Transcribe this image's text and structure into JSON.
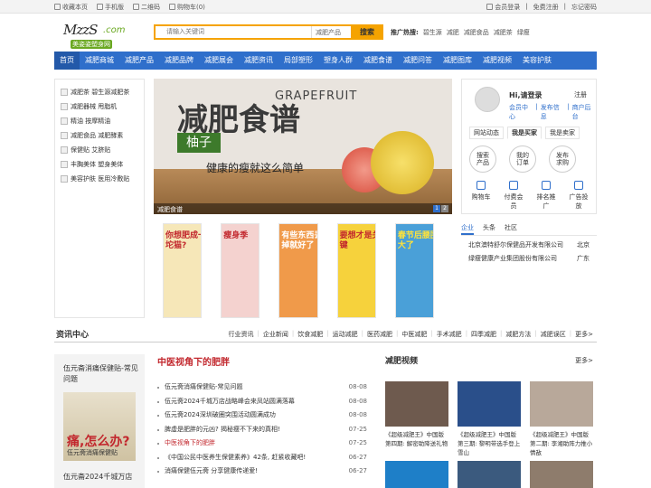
{
  "topbar": {
    "left": [
      "收藏本页",
      "手机版",
      "二维码",
      "购物车(0)"
    ],
    "right": [
      "会员登录",
      "免费注册",
      "忘记密码"
    ]
  },
  "logo": {
    "main": "MzzS",
    "com": ".com",
    "sub": "美姿姿塑身网"
  },
  "search": {
    "placeholder": "请输入关键词",
    "category": "减肥产品",
    "button": "搜索"
  },
  "hot": {
    "label": "推广热搜:",
    "items": [
      "碧生源",
      "减肥",
      "减肥食品",
      "减肥茶",
      "绿瘦"
    ]
  },
  "nav": [
    "首页",
    "减肥商城",
    "减肥产品",
    "减肥品牌",
    "减肥展会",
    "减肥资讯",
    "局部塑形",
    "塑身人群",
    "减肥食谱",
    "减肥问答",
    "减肥图库",
    "减肥视频",
    "美容护肤"
  ],
  "sidebar": [
    "减肥茶 碧生源减肥茶",
    "减肥器械 甩脂机",
    "精油 按摩精油",
    "减肥食品 减肥酵素",
    "保健贴 艾脐贴",
    "丰胸美体 塑身美体",
    "美容护肤 医用冷敷贴"
  ],
  "banner": {
    "title": "减肥食谱",
    "eng": "GRAPEFRUIT",
    "tag": "柚子",
    "slogan": "健康的瘦就这么简单",
    "caption": "减肥食谱",
    "pages": [
      "1",
      "2"
    ]
  },
  "ads": [
    "你想肥成一坨猫?",
    "瘦身季",
    "有些东西丢掉就好了",
    "要想才是关键",
    "春节后腰围大了"
  ],
  "user": {
    "greeting": "Hi,请登录",
    "register": "注册",
    "links": [
      "会员中心",
      "发布信息",
      "商户后台"
    ],
    "tabs": [
      "网站动态",
      "我是买家",
      "我是卖家"
    ],
    "circles": [
      [
        "搜索",
        "产品"
      ],
      [
        "我的",
        "订单"
      ],
      [
        "发布",
        "求购"
      ]
    ],
    "actions": [
      "购物车",
      "付费会员",
      "排名推广",
      "广告投放"
    ]
  },
  "corp": {
    "tabs": [
      "企业",
      "头条",
      "社区"
    ],
    "rows": [
      [
        "北京澳特舒尔保健品开发有限公司",
        "北京"
      ],
      [
        "绿瘦健康产业集团股份有限公司",
        "广东"
      ]
    ]
  },
  "news": {
    "title": "资讯中心",
    "cats": [
      "行业资讯",
      "企业新闻",
      "饮食减肥",
      "运动减肥",
      "医药减肥",
      "中医减肥",
      "手术减肥",
      "四季减肥",
      "减肥方法",
      "减肥误区",
      "更多>"
    ],
    "left_title": "伍元斋消痛保健贴-常见问题",
    "left_img_big": "痛,怎么办?",
    "left_img_small": "伍元斋消痛保健贴",
    "left_title2": "伍元斋2024千城万店",
    "mid_title": "中医视角下的肥胖",
    "list": [
      [
        "伍元斋消痛保健贴-常见问题",
        "08-08"
      ],
      [
        "伍元斋2024千城万店战略峰会来凤站圆满落幕",
        "08-08"
      ],
      [
        "伍元斋2024深圳破圈突围活动圆满成功",
        "08-08"
      ],
      [
        "脾虚是肥胖的元凶? 揭秘瘦不下来的真相!",
        "07-25"
      ],
      [
        "中医视角下的肥胖",
        "07-25"
      ],
      [
        "《中国公民中医养生保健素养》42条, 赶紧收藏吧!",
        "06-27"
      ],
      [
        "消痛保健伍元斋 分享健康传递爱!",
        "06-27"
      ]
    ]
  },
  "video": {
    "title": "减肥视频",
    "more": "更多>",
    "items": [
      "《超级减肥王》中国版第四期: 解密助降送礼物",
      "《超级减肥王》中国版第三期: 黎明带选手登上雪山",
      "《超级减肥王》中国版第二期: 李湘助阵力推小情敌"
    ]
  }
}
